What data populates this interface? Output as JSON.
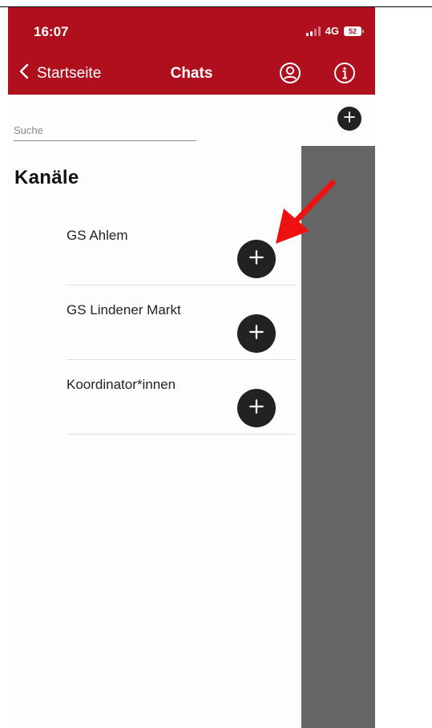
{
  "status_bar": {
    "time": "16:07",
    "network": "4G",
    "battery": "52"
  },
  "header": {
    "back_label": "Startseite",
    "title": "Chats",
    "profile_icon": "person-circle-icon",
    "info_icon": "info-circle-icon",
    "background_color": "#b0101e"
  },
  "search": {
    "placeholder": "Suche",
    "value": ""
  },
  "channels_section": {
    "title": "Kanäle",
    "items": [
      {
        "name": "GS Ahlem"
      },
      {
        "name": "GS Lindener Markt"
      },
      {
        "name": "Koordinator*innen"
      }
    ]
  },
  "annotation": {
    "arrow_color": "#ee1111"
  }
}
